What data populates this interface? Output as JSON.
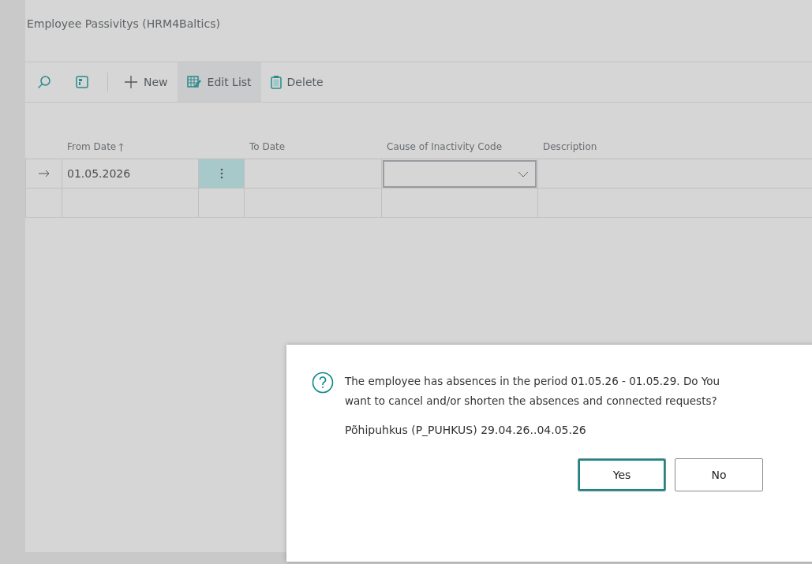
{
  "page": {
    "title": "Employee Passivitys (HRM4Baltics)"
  },
  "toolbar": [
    {
      "kind": "search"
    },
    {
      "kind": "layout"
    },
    {
      "kind": "new",
      "label": "New",
      "selected": false
    },
    {
      "kind": "edit",
      "label": "Edit List",
      "selected": true
    },
    {
      "kind": "delete",
      "label": "Delete",
      "selected": false
    }
  ],
  "table": {
    "columns": [
      {
        "label": "From Date",
        "sorted": true
      },
      {
        "label": "To Date",
        "sorted": false
      },
      {
        "label": "Cause of Inactivity Code",
        "sorted": false
      },
      {
        "label": "Description",
        "sorted": false
      }
    ],
    "rows": [
      {
        "selected": true,
        "from_date": "01.05.2026"
      },
      {
        "selected": false
      }
    ]
  },
  "dialog": {
    "message": "The employee has absences in the period 01.05.26 - 01.05.29. Do You want to cancel and/or shorten the absences and connected requests?",
    "detail": "Põhipuhkus (P_PUHKUS) 29.04.26..04.05.26",
    "buttons": [
      {
        "label": "Yes",
        "selected": true
      },
      {
        "label": "No",
        "selected": false
      }
    ]
  }
}
